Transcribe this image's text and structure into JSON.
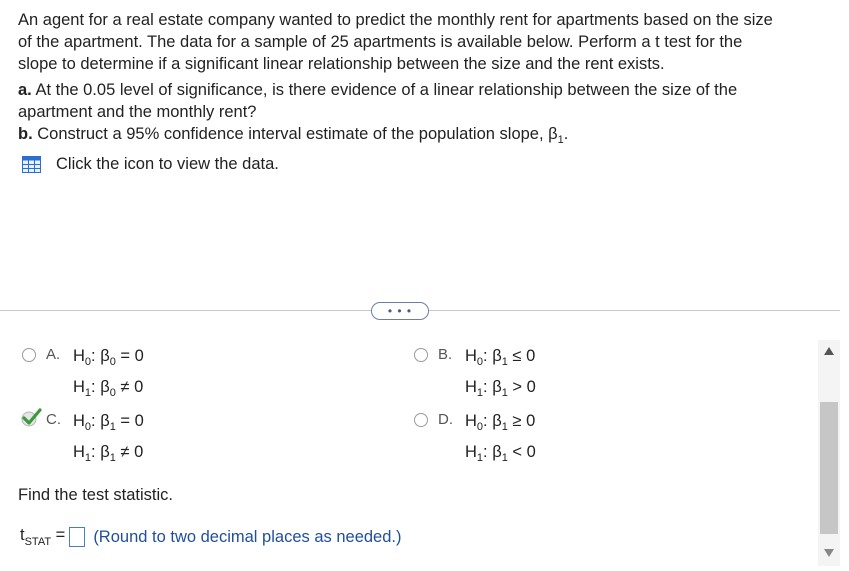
{
  "question": {
    "intro_lines": [
      "An agent for a real estate company wanted to predict the monthly rent for apartments based on the size",
      "of the apartment. The data for a sample of 25 apartments is available below. Perform a t test for the",
      "slope to determine if a significant linear relationship between the size and the rent exists."
    ],
    "part_a_label": "a.",
    "part_a_lines": [
      " At the 0.05 level of significance, is there evidence of a linear relationship between the size of the",
      "apartment and the monthly rent?"
    ],
    "part_b_label": "b.",
    "part_b_text": " Construct a 95% confidence interval estimate of the population slope, β",
    "part_b_sub": "1",
    "part_b_end": ".",
    "data_link_text": "Click the icon to view the data."
  },
  "more_button": "• • •",
  "options": [
    {
      "letter": "A.",
      "h0_pre": "H",
      "h0_sub": "0",
      "h0_mid": ": β",
      "h0_bsub": "0",
      "h0_rel": " = 0",
      "h1_pre": "H",
      "h1_sub": "1",
      "h1_mid": ": β",
      "h1_bsub": "0",
      "h1_rel": " ≠ 0"
    },
    {
      "letter": "B.",
      "h0_pre": "H",
      "h0_sub": "0",
      "h0_mid": ": β",
      "h0_bsub": "1",
      "h0_rel": " ≤ 0",
      "h1_pre": "H",
      "h1_sub": "1",
      "h1_mid": ": β",
      "h1_bsub": "1",
      "h1_rel": " > 0"
    },
    {
      "letter": "C.",
      "h0_pre": "H",
      "h0_sub": "0",
      "h0_mid": ": β",
      "h0_bsub": "1",
      "h0_rel": " = 0",
      "h1_pre": "H",
      "h1_sub": "1",
      "h1_mid": ": β",
      "h1_bsub": "1",
      "h1_rel": " ≠ 0"
    },
    {
      "letter": "D.",
      "h0_pre": "H",
      "h0_sub": "0",
      "h0_mid": ": β",
      "h0_bsub": "1",
      "h0_rel": " ≥ 0",
      "h1_pre": "H",
      "h1_sub": "1",
      "h1_mid": ": β",
      "h1_bsub": "1",
      "h1_rel": " < 0"
    }
  ],
  "selected_option": "C.",
  "find_text": "Find the test statistic.",
  "tstat": {
    "t": "t",
    "sub": "STAT",
    "eq": " =",
    "note": "(Round to two decimal places as needed.)"
  },
  "colors": {
    "check": "#3c9a3c",
    "note": "#1f4e9e",
    "link_icon": "#2a6fcf"
  }
}
